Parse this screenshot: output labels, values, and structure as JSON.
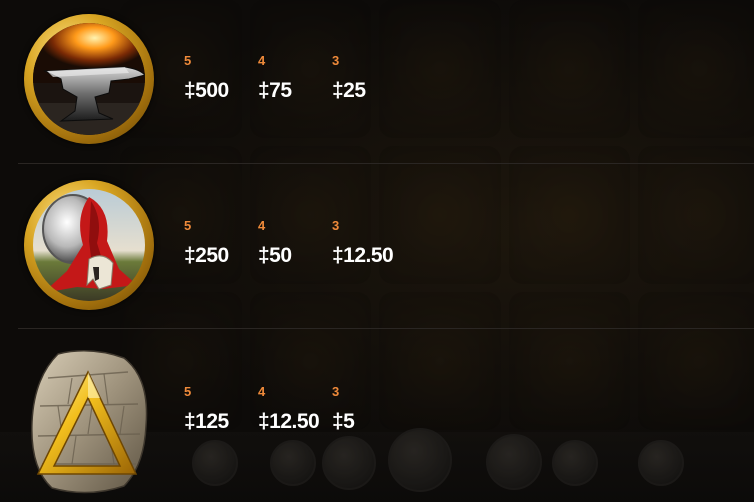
{
  "paytable": [
    {
      "symbol": "anvil-icon",
      "payouts": [
        {
          "count": "5",
          "amount": "‡500"
        },
        {
          "count": "4",
          "amount": "‡75"
        },
        {
          "count": "3",
          "amount": "‡25"
        }
      ]
    },
    {
      "symbol": "spartan-helmet-cape-icon",
      "payouts": [
        {
          "count": "5",
          "amount": "‡250"
        },
        {
          "count": "4",
          "amount": "‡50"
        },
        {
          "count": "3",
          "amount": "‡12.50"
        }
      ]
    },
    {
      "symbol": "stone-triangle-icon",
      "payouts": [
        {
          "count": "5",
          "amount": "‡125"
        },
        {
          "count": "4",
          "amount": "‡12.50"
        },
        {
          "count": "3",
          "amount": "‡5"
        }
      ]
    }
  ],
  "colors": {
    "count": "#ef8a3a",
    "amount": "#ffffff",
    "gold": "#d9a623",
    "background": "#0d0b09"
  }
}
